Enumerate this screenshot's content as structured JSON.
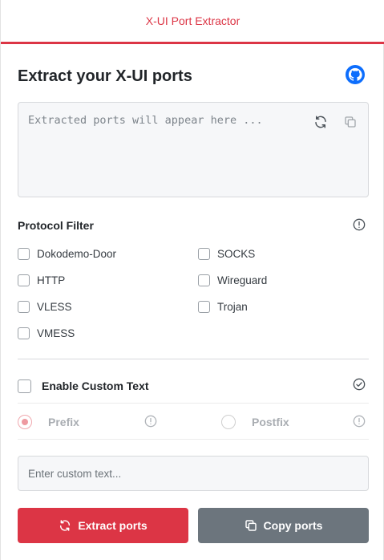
{
  "app": {
    "title": "X-UI Port Extractor",
    "accent": "#dc3545"
  },
  "main": {
    "heading": "Extract your X-UI ports",
    "github_icon": "github-icon"
  },
  "output": {
    "placeholder": "Extracted ports will appear here ...",
    "refresh_icon": "refresh-icon",
    "copy_icon": "copy-icon"
  },
  "protocol_filter": {
    "title": "Protocol Filter",
    "info_icon": "info-icon",
    "items": [
      {
        "label": "Dokodemo-Door",
        "checked": false
      },
      {
        "label": "SOCKS",
        "checked": false
      },
      {
        "label": "HTTP",
        "checked": false
      },
      {
        "label": "Wireguard",
        "checked": false
      },
      {
        "label": "VLESS",
        "checked": false
      },
      {
        "label": "Trojan",
        "checked": false
      },
      {
        "label": "VMESS",
        "checked": false
      }
    ]
  },
  "custom_text": {
    "label": "Enable Custom Text",
    "enabled": false,
    "status_icon": "check-circle-icon",
    "options": [
      {
        "label": "Prefix",
        "selected": true
      },
      {
        "label": "Postfix",
        "selected": false
      }
    ],
    "input_placeholder": "Enter custom text..."
  },
  "actions": {
    "extract_label": "Extract ports",
    "extract_color": "#dc3545",
    "copy_label": "Copy ports",
    "copy_color": "#6c757d"
  }
}
